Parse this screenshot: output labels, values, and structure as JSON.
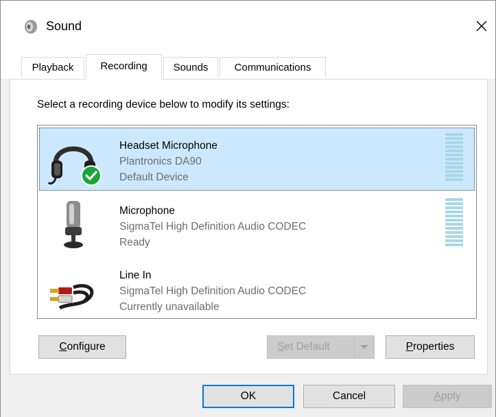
{
  "window": {
    "title": "Sound",
    "icons": {
      "app": "speaker-icon",
      "close": "close-icon"
    }
  },
  "tabs": [
    {
      "label": "Playback",
      "active": false
    },
    {
      "label": "Recording",
      "active": true
    },
    {
      "label": "Sounds",
      "active": false
    },
    {
      "label": "Communications",
      "active": false
    }
  ],
  "instruction": "Select a recording device below to modify its settings:",
  "devices": [
    {
      "name": "Headset Microphone",
      "driver": "Plantronics DA90",
      "status": "Default Device",
      "selected": true,
      "icon": "headset-icon",
      "badge": "checkmark-icon"
    },
    {
      "name": "Microphone",
      "driver": "SigmaTel High Definition Audio CODEC",
      "status": "Ready",
      "selected": false,
      "icon": "microphone-icon"
    },
    {
      "name": "Line In",
      "driver": "SigmaTel High Definition Audio CODEC",
      "status": "Currently unavailable",
      "selected": false,
      "icon": "audio-cable-icon"
    }
  ],
  "buttons": {
    "configure": {
      "label": "Configure",
      "mnemonic": "C"
    },
    "set_default": {
      "label": "Set Default",
      "mnemonic": "S",
      "enabled": false
    },
    "properties": {
      "label": "Properties",
      "mnemonic": "P"
    },
    "ok": {
      "label": "OK"
    },
    "cancel": {
      "label": "Cancel"
    },
    "apply": {
      "label": "Apply",
      "mnemonic": "A",
      "enabled": false
    }
  },
  "colors": {
    "selection": "#cce8ff",
    "focus": "#0078d7",
    "level_meter": "#a8d8e8",
    "badge": "#1ca33a"
  }
}
